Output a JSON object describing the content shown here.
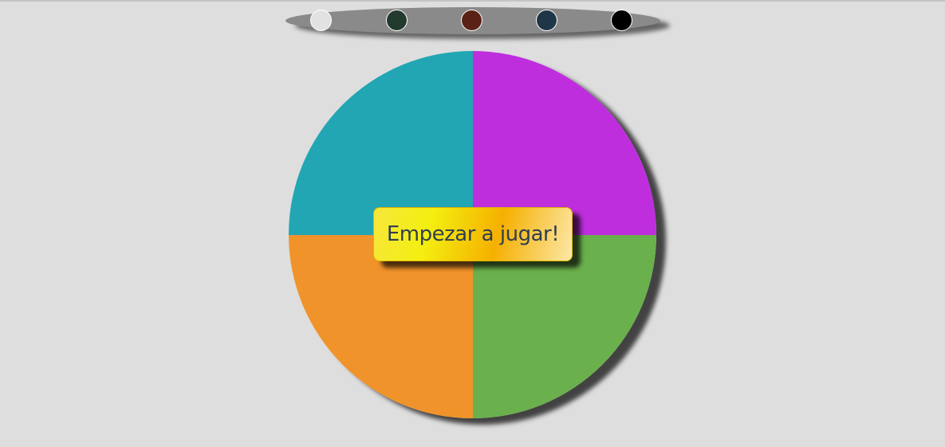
{
  "palette": {
    "swatches": [
      {
        "name": "light-gray",
        "color": "#e2e2e2"
      },
      {
        "name": "dark-green",
        "color": "#233a2e"
      },
      {
        "name": "dark-brown",
        "color": "#5a2216"
      },
      {
        "name": "dark-slate",
        "color": "#1f3646"
      },
      {
        "name": "black",
        "color": "#000000"
      }
    ]
  },
  "wheel": {
    "quadrants": [
      {
        "position": "top-left",
        "color": "#22a6b3"
      },
      {
        "position": "top-right",
        "color": "#be2edd"
      },
      {
        "position": "bottom-left",
        "color": "#f0932b"
      },
      {
        "position": "bottom-right",
        "color": "#6ab04c"
      }
    ]
  },
  "start_button": {
    "label": "Empezar a jugar!"
  }
}
